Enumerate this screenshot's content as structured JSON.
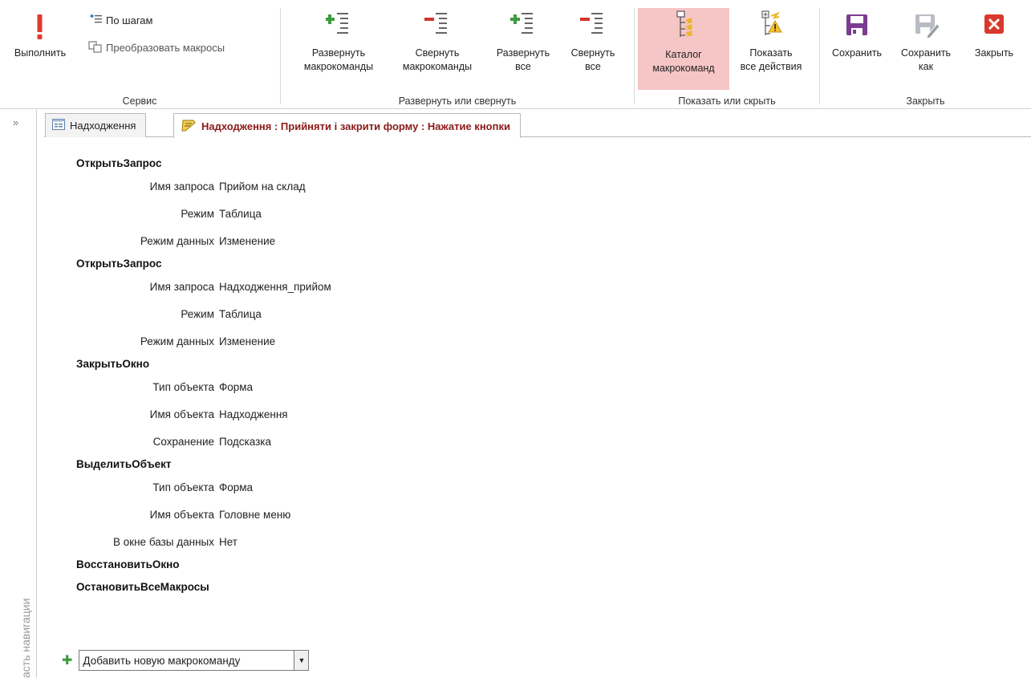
{
  "ribbon": {
    "service": {
      "label": "Сервис",
      "run": "Выполнить",
      "step": "По шагам",
      "convert": "Преобразовать макросы"
    },
    "expand_group": {
      "label": "Развернуть или свернуть",
      "expand_actions": [
        "Развернуть",
        "макрокоманды"
      ],
      "collapse_actions": [
        "Свернуть",
        "макрокоманды"
      ],
      "expand_all": [
        "Развернуть",
        "все"
      ],
      "collapse_all": [
        "Свернуть",
        "все"
      ]
    },
    "show_group": {
      "label": "Показать или скрыть",
      "catalog": [
        "Каталог",
        "макрокоманд"
      ],
      "show_all": [
        "Показать",
        "все действия"
      ]
    },
    "close_group": {
      "label": "Закрыть",
      "save": "Сохранить",
      "save_as": [
        "Сохранить",
        "как"
      ],
      "close": "Закрыть"
    }
  },
  "tabs": [
    {
      "label": "Надходження"
    },
    {
      "label": "Надходження : Прийняти і закрити форму : Нажатие кнопки"
    }
  ],
  "nav": {
    "chevron": "»",
    "label": "асть навигации"
  },
  "macro": [
    {
      "action": "ОткрытьЗапрос",
      "args": [
        {
          "label": "Имя запроса",
          "value": "Прийом на склад"
        },
        {
          "label": "Режим",
          "value": "Таблица"
        },
        {
          "label": "Режим данных",
          "value": "Изменение"
        }
      ]
    },
    {
      "action": "ОткрытьЗапрос",
      "args": [
        {
          "label": "Имя запроса",
          "value": "Надходження_прийом"
        },
        {
          "label": "Режим",
          "value": "Таблица"
        },
        {
          "label": "Режим данных",
          "value": "Изменение"
        }
      ]
    },
    {
      "action": "ЗакрытьОкно",
      "args": [
        {
          "label": "Тип объекта",
          "value": "Форма"
        },
        {
          "label": "Имя объекта",
          "value": "Надходження"
        },
        {
          "label": "Сохранение",
          "value": "Подсказка"
        }
      ]
    },
    {
      "action": "ВыделитьОбъект",
      "args": [
        {
          "label": "Тип объекта",
          "value": "Форма"
        },
        {
          "label": "Имя объекта",
          "value": "Головне меню"
        },
        {
          "label": "В окне базы данных",
          "value": "Нет"
        }
      ]
    },
    {
      "action": "ВосстановитьОкно",
      "args": []
    },
    {
      "action": "ОстановитьВсеМакросы",
      "args": []
    }
  ],
  "add_new": {
    "value": "Добавить новую макрокоманду"
  },
  "colors": {
    "accent_red": "#e03a2f",
    "save_purple": "#7a3c8f",
    "plus_green": "#3f9a3f",
    "active_bg": "#f6c5c5"
  }
}
